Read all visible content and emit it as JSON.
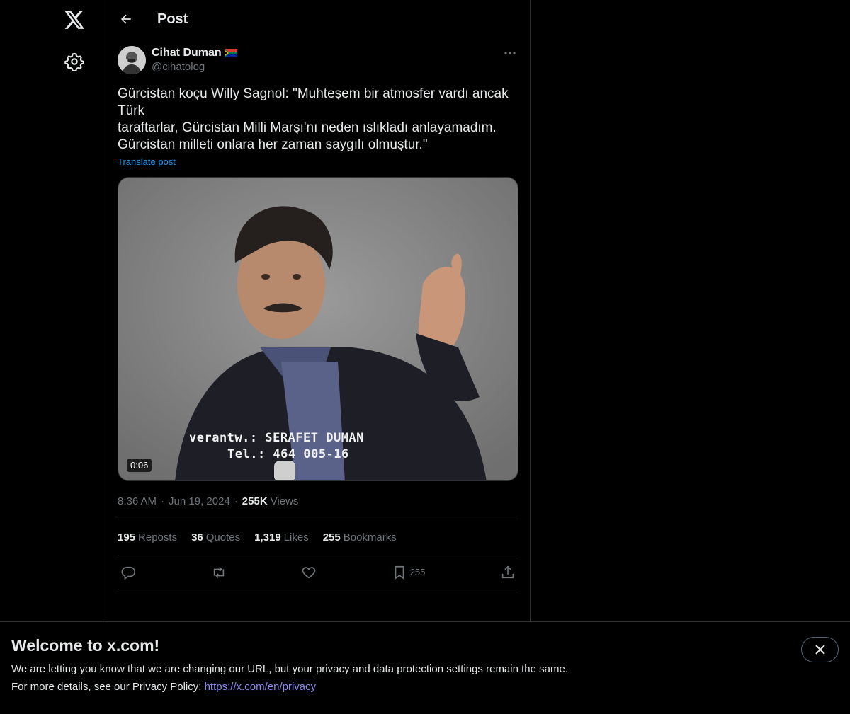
{
  "topbar": {
    "title": "Post"
  },
  "post": {
    "author_name": "Cihat Duman",
    "handle": "@cihatolog",
    "text": "Gürcistan koçu Willy Sagnol: \"Muhteşem bir atmosfer vardı ancak Türk\ntaraftarlar, Gürcistan Milli Marşı'nı neden ıslıkladı anlayamadım.\nGürcistan milleti onlara her zaman saygılı olmuştur.\"",
    "translate_label": "Translate post",
    "video": {
      "duration": "0:06",
      "caption_line1": "verantw.: SERAFET DUMAN",
      "caption_line2": "Tel.: 464 005-16"
    },
    "time": "8:36 AM",
    "date": "Jun 19, 2024",
    "views_count": "255K",
    "views_label": "Views"
  },
  "stats": {
    "reposts_count": "195",
    "reposts_label": "Reposts",
    "quotes_count": "36",
    "quotes_label": "Quotes",
    "likes_count": "1,319",
    "likes_label": "Likes",
    "bookmarks_count": "255",
    "bookmarks_label": "Bookmarks"
  },
  "actions": {
    "bookmark_count": "255"
  },
  "banner": {
    "title": "Welcome to x.com!",
    "line1": "We are letting you know that we are changing our URL, but your privacy and data protection settings remain the same.",
    "line2_prefix": "For more details, see our Privacy Policy: ",
    "link": "https://x.com/en/privacy"
  },
  "icons": {
    "logo": "x-logo-icon",
    "settings": "gear-icon",
    "back": "arrow-left-icon",
    "more": "more-horizontal-icon",
    "reply": "reply-icon",
    "repost": "repost-icon",
    "like": "heart-icon",
    "bookmark": "bookmark-icon",
    "share": "share-icon",
    "close": "close-icon"
  },
  "colors": {
    "background": "#000000",
    "text": "#e7e9ea",
    "muted": "#71767b",
    "accent": "#1d9bf0",
    "border": "#2f3336"
  }
}
